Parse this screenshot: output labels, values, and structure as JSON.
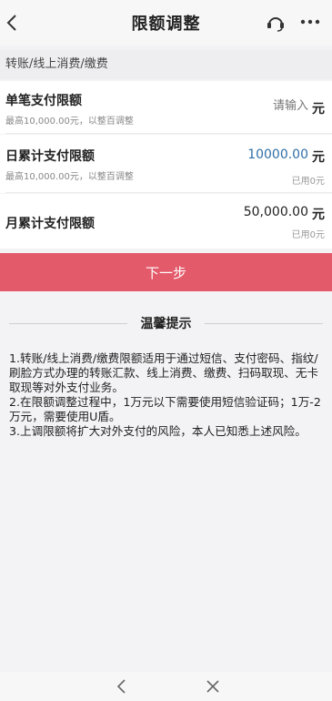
{
  "header": {
    "title": "限额调整"
  },
  "section": {
    "title": "转账/线上消费/缴费"
  },
  "rows": {
    "single": {
      "label": "单笔支付限额",
      "hint": "最高10,000.00元，以整百调整",
      "placeholder": "请输入",
      "unit": "元"
    },
    "daily": {
      "label": "日累计支付限额",
      "hint": "最高10,000.00元，以整百调整",
      "value": "10000.00",
      "unit": "元",
      "used": "已用0元"
    },
    "monthly": {
      "label": "月累计支付限额",
      "value": "50,000.00",
      "unit": "元",
      "used": "已用0元"
    }
  },
  "next_button": "下一步",
  "tips": {
    "title": "温馨提示",
    "items": [
      "1.转账/线上消费/缴费限额适用于通过短信、支付密码、指纹/刷脸方式办理的转账汇款、线上消费、缴费、扫码取现、无卡取现等对外支付业务。",
      "2.在限额调整过程中，1万元以下需要使用短信验证码；1万-2万元，需要使用U盾。",
      "3.上调限额将扩大对外支付的风险，本人已知悉上述风险。"
    ]
  },
  "colors": {
    "accent_button": "#e35a6a",
    "value_blue": "#2f6fa6"
  },
  "icons": [
    "back-chevron-icon",
    "headset-support-icon",
    "more-dots-icon",
    "nav-back-icon",
    "nav-close-icon"
  ]
}
